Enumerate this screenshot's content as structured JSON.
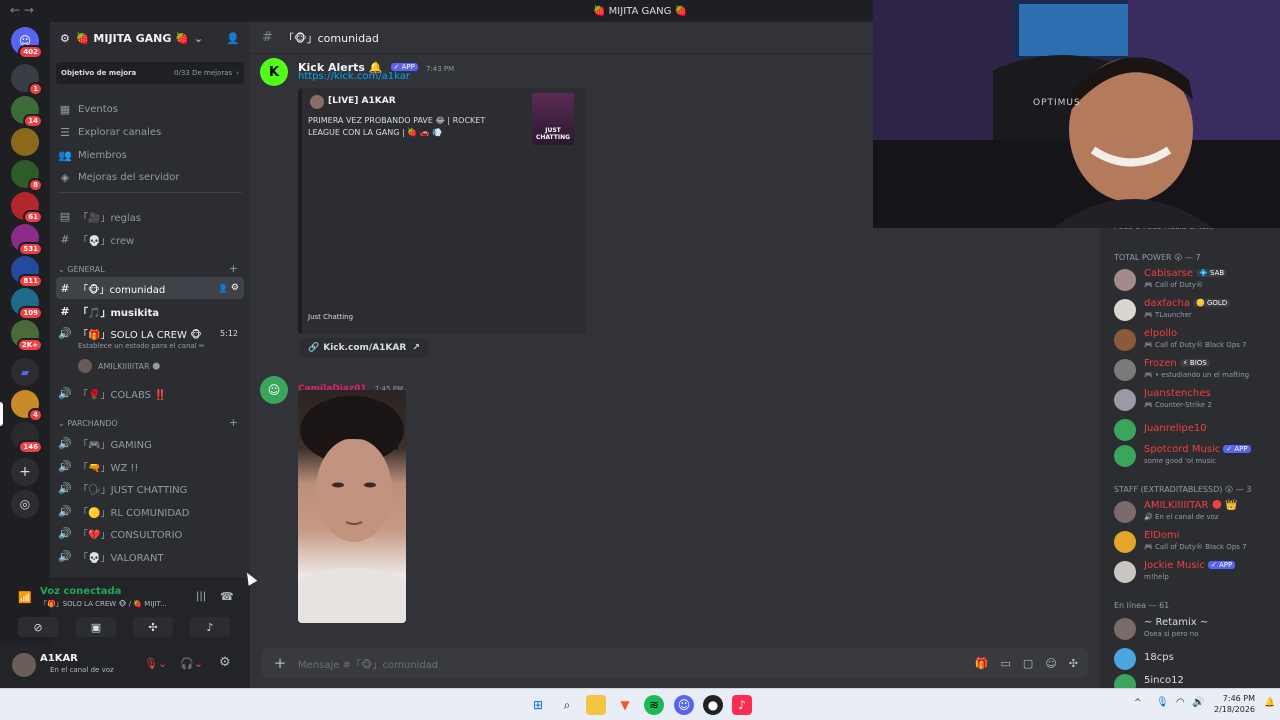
{
  "window": {
    "title": "🍓 MIJITA GANG 🍓"
  },
  "rail": {
    "guilds": [
      {
        "badge": "402",
        "color": "#5865f2"
      },
      {
        "badge": "1",
        "color": "#3a3d44"
      },
      {
        "badge": "14",
        "color": "#3c6b3a"
      },
      {
        "badge": "",
        "color": "#8a6a1a"
      },
      {
        "badge": "8",
        "color": "#2f5a2a"
      },
      {
        "badge": "61",
        "color": "#b3262b"
      },
      {
        "badge": "531",
        "color": "#8b2b8a"
      },
      {
        "badge": "811",
        "color": "#234a9c"
      },
      {
        "badge": "109",
        "color": "#1f6a8a"
      },
      {
        "badge": "2K+",
        "color": "#4a6a3a"
      },
      {
        "badge": "",
        "color": "#5865f2"
      },
      {
        "badge": "4",
        "color": "#c98a2a"
      },
      {
        "badge": "146",
        "color": "#2a2a2a"
      }
    ]
  },
  "server": {
    "name": "🍓 MIJITA GANG 🍓",
    "boost": {
      "label": "Objetivo de mejora",
      "progress": "0/33 De mejoras"
    },
    "menu": [
      "Eventos",
      "Explorar canales",
      "Miembros",
      "Mejoras del servidor"
    ],
    "top_channels": [
      {
        "name": "「🎥」reglas"
      },
      {
        "name": "「💀」crew"
      }
    ],
    "cat_general": "GENERAL",
    "general": [
      {
        "name": "「🐵」comunidad"
      },
      {
        "name": "「🎵」musikita"
      },
      {
        "name": "「🎁」SOLO LA CREW 🐵",
        "time": "5:12"
      },
      {
        "name": "「🌹」COLABS ‼️"
      }
    ],
    "voice_status_hint": "Establece un estado para el canal ✏",
    "voice_member": "AMILKIIIIITAR 🌑",
    "cat_parchando": "PARCHANDO",
    "parchando": [
      {
        "name": "「🎮」GAMING"
      },
      {
        "name": "「🔫」WZ !!"
      },
      {
        "name": "「🗣」JUST CHATTING"
      },
      {
        "name": "「🟡」RL COMUNIDAD"
      },
      {
        "name": "「💔」CONSULTORIO"
      },
      {
        "name": "「💀」VALORANT"
      }
    ]
  },
  "voice_panel": {
    "status": "Voz conectada",
    "location": "「🎁」SOLO LA CREW 🐵 / 🍓 MIJIT..."
  },
  "user_panel": {
    "name": "A1KAR",
    "status": "En el canal de voz"
  },
  "chat": {
    "channel": "「🐵」comunidad",
    "messages": [
      {
        "author": "Kick Alerts 🔔",
        "tag": "✓ APP",
        "time": "7:43 PM",
        "link": "https://kick.com/a1kar",
        "embed": {
          "title": "[LIVE] A1KAR",
          "description": "PRIMERA VEZ PROBANDO PAVE 😂 | ROCKET LEAGUE CON LA GANG | 🍓 🚗 💨",
          "thumb_label": "JUST CHATTING",
          "footer": "Just Chatting"
        },
        "button": "Kick.com/A1KAR"
      },
      {
        "author": "CamilaDiaz01",
        "time": "7:45 PM"
      }
    ],
    "input_placeholder": "Mensaje #「🐵」comunidad"
  },
  "members": {
    "peek_text": "Poco a Poco    Hacia el to...",
    "groups": [
      {
        "title": "TOTAL POWER 😮 — 7",
        "items": [
          {
            "name": "Cabisarse",
            "tag": "💠 SAB",
            "activity": "🎮 Call of Duty®",
            "color": "#f23f43"
          },
          {
            "name": "daxfacha",
            "tag": "🪙 GOLD",
            "activity": "🎮 TLauncher",
            "color": "#f23f43"
          },
          {
            "name": "elpollo",
            "tag": "",
            "activity": "🎮 Call of Duty® Black Ops 7",
            "color": "#f23f43"
          },
          {
            "name": "Frozen",
            "tag": "⚡ BIOS",
            "activity": "🎮 • estudiando un el mafting",
            "color": "#f23f43"
          },
          {
            "name": "Juanstenches",
            "tag": "",
            "activity": "🎮 Counter-Strike 2",
            "color": "#f23f43"
          },
          {
            "name": "Juanrelipe10",
            "tag": "",
            "activity": "",
            "color": "#f23f43"
          },
          {
            "name": "Spotcord Music",
            "tag": "✓ APP",
            "activity": "some good 'ol music",
            "color": "#f23f43"
          }
        ]
      },
      {
        "title": "STAFF (EXTRADITABLESSD) 😮 — 3",
        "items": [
          {
            "name": "AMILKIIIIITAR 🌑 👑",
            "tag": "",
            "activity": "🔊 En el canal de voz",
            "color": "#f23f43"
          },
          {
            "name": "ElDomi",
            "tag": "",
            "activity": "🎮 Call of Duty® Black Ops 7",
            "color": "#f23f43"
          },
          {
            "name": "Jockie Music",
            "tag": "✓ APP",
            "activity": "m!help",
            "color": "#f23f43"
          }
        ]
      },
      {
        "title": "En línea — 61",
        "items": [
          {
            "name": "~ Retamix ~",
            "tag": "",
            "activity": "Osea si pero no",
            "color": "#dbdee1"
          },
          {
            "name": "18cps",
            "tag": "",
            "activity": "",
            "color": "#dbdee1"
          },
          {
            "name": "5inco12",
            "tag": "",
            "activity": "",
            "color": "#dbdee1"
          }
        ]
      }
    ]
  },
  "webcam": {
    "brand": "OPTIMUS"
  },
  "taskbar": {
    "time": "7:46 PM",
    "date": "2/18/2026"
  },
  "colors": {
    "accent": "#5865f2",
    "kick_green": "#53fc18",
    "mention_red": "#f23f43",
    "link": "#00a8fc"
  }
}
